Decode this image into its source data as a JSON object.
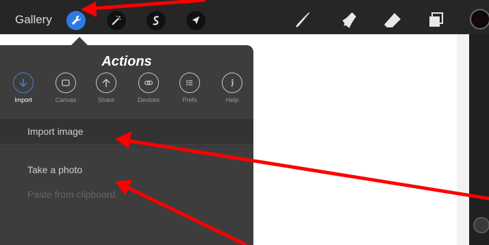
{
  "toolbar": {
    "gallery_label": "Gallery",
    "buttons": [
      {
        "name": "actions-button",
        "icon": "wrench-icon",
        "active": true
      },
      {
        "name": "adjustments-button",
        "icon": "magic-wand-icon"
      },
      {
        "name": "selection-button",
        "icon": "selection-icon"
      },
      {
        "name": "transform-button",
        "icon": "arrow-cursor-icon"
      }
    ],
    "tools": [
      {
        "name": "brush-tool",
        "icon": "brush-icon"
      },
      {
        "name": "smudge-tool",
        "icon": "smudge-icon"
      },
      {
        "name": "eraser-tool",
        "icon": "eraser-icon"
      },
      {
        "name": "layers-tool",
        "icon": "layers-icon"
      }
    ],
    "color_swatch": "#13060c"
  },
  "actions_panel": {
    "title": "Actions",
    "categories": [
      {
        "label": "Import",
        "icon": "down-arrow-icon",
        "active": true
      },
      {
        "label": "Canvas",
        "icon": "canvas-icon"
      },
      {
        "label": "Share",
        "icon": "up-arrow-icon"
      },
      {
        "label": "Devices",
        "icon": "link-icon"
      },
      {
        "label": "Prefs",
        "icon": "list-icon"
      },
      {
        "label": "Help",
        "icon": "info-icon"
      }
    ],
    "items": [
      {
        "label": "Import image",
        "enabled": true
      },
      {
        "label": "Take a photo",
        "enabled": true
      },
      {
        "label": "Paste from clipboard",
        "enabled": false
      }
    ]
  },
  "colors": {
    "accent": "#2f7be5",
    "annotation": "#ff0000"
  }
}
